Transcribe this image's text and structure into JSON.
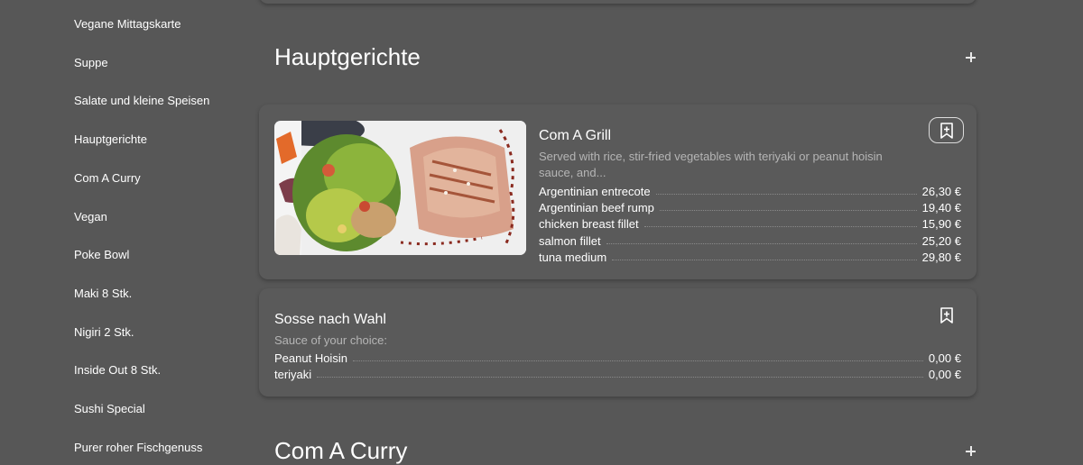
{
  "sidebar": {
    "items": [
      {
        "label": "Vegane Mittagskarte"
      },
      {
        "label": "Suppe"
      },
      {
        "label": "Salate und kleine Speisen"
      },
      {
        "label": "Hauptgerichte"
      },
      {
        "label": "Com A Curry"
      },
      {
        "label": "Vegan"
      },
      {
        "label": "Poke Bowl"
      },
      {
        "label": "Maki 8 Stk."
      },
      {
        "label": "Nigiri 2 Stk."
      },
      {
        "label": "Inside Out 8 Stk."
      },
      {
        "label": "Sushi Special"
      },
      {
        "label": "Purer roher Fischgenuss"
      }
    ]
  },
  "sections": {
    "main": {
      "title": "Hauptgerichte",
      "expand_icon": "plus-icon"
    },
    "next": {
      "title": "Com A Curry",
      "expand_icon": "plus-icon"
    }
  },
  "items": [
    {
      "title": "Com A Grill",
      "description": "Served with rice, stir-fried vegetables with teriyaki or peanut hoisin sauce, and...",
      "image": "grilled salmon with salad",
      "bookmark_icon": "bookmark-add-icon",
      "prices": [
        {
          "name": "Argentinian entrecote",
          "price": "26,30 €"
        },
        {
          "name": "Argentinian beef rump",
          "price": "19,40 €"
        },
        {
          "name": "chicken breast fillet",
          "price": "15,90 €"
        },
        {
          "name": "salmon fillet",
          "price": "25,20 €"
        },
        {
          "name": "tuna medium",
          "price": "29,80 €"
        }
      ]
    },
    {
      "title": "Sosse nach Wahl",
      "description": "Sauce of your choice:",
      "bookmark_icon": "bookmark-add-icon",
      "prices": [
        {
          "name": "Peanut Hoisin",
          "price": "0,00 €"
        },
        {
          "name": "teriyaki",
          "price": "0,00 €"
        }
      ]
    }
  ]
}
